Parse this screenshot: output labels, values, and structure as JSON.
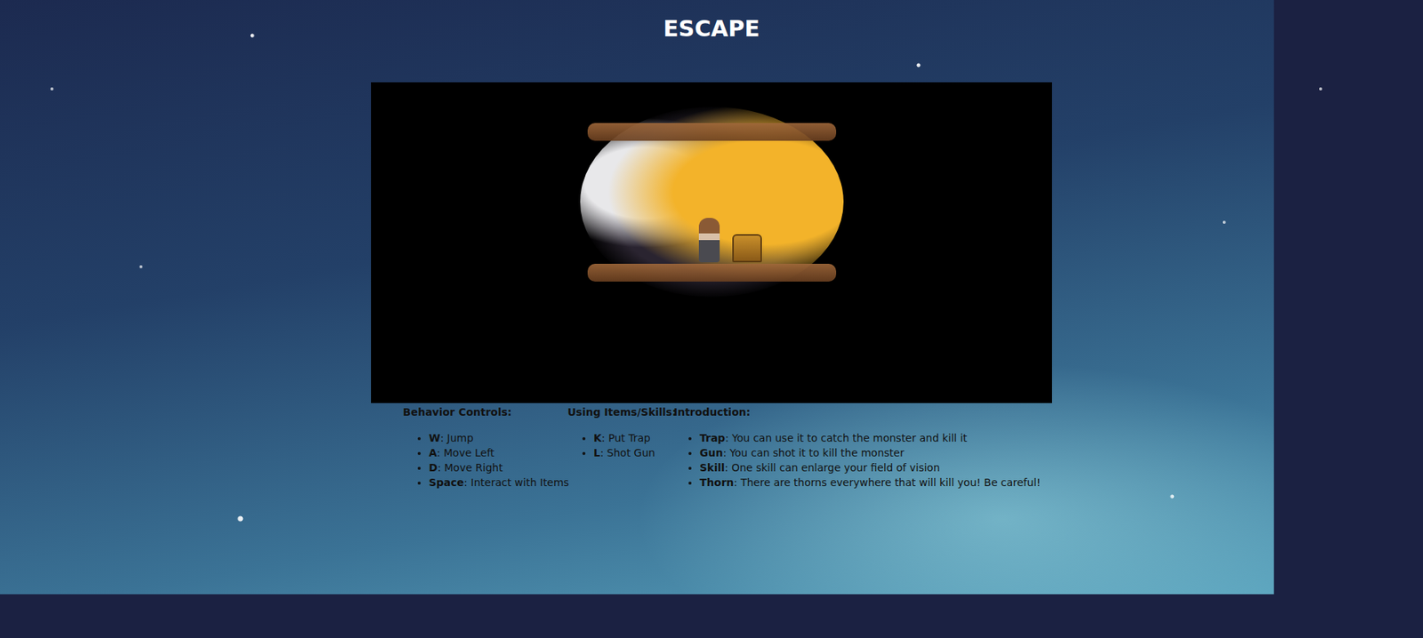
{
  "page": {
    "title": "ESCAPE"
  },
  "game": {
    "kind": "canvas"
  },
  "sections": [
    {
      "heading": "Behavior Controls:",
      "items": [
        {
          "label": "W",
          "text": ": Jump"
        },
        {
          "label": "A",
          "text": ": Move Left"
        },
        {
          "label": "D",
          "text": ": Move Right"
        },
        {
          "label": "Space",
          "text": ": Interact with Items"
        }
      ]
    },
    {
      "heading": "Using Items/Skills:",
      "items": [
        {
          "label": "K",
          "text": ": Put Trap"
        },
        {
          "label": "L",
          "text": ": Shot Gun"
        }
      ]
    },
    {
      "heading": "Introduction:",
      "items": [
        {
          "label": "Trap",
          "text": ": You can use it to catch the monster and kill it"
        },
        {
          "label": "Gun",
          "text": ": You can shot it to kill the monster"
        },
        {
          "label": "Skill",
          "text": ": One skill can enlarge your field of vision"
        },
        {
          "label": "Thorn",
          "text": ": There are thorns everywhere that will kill you! Be careful!"
        }
      ]
    }
  ]
}
